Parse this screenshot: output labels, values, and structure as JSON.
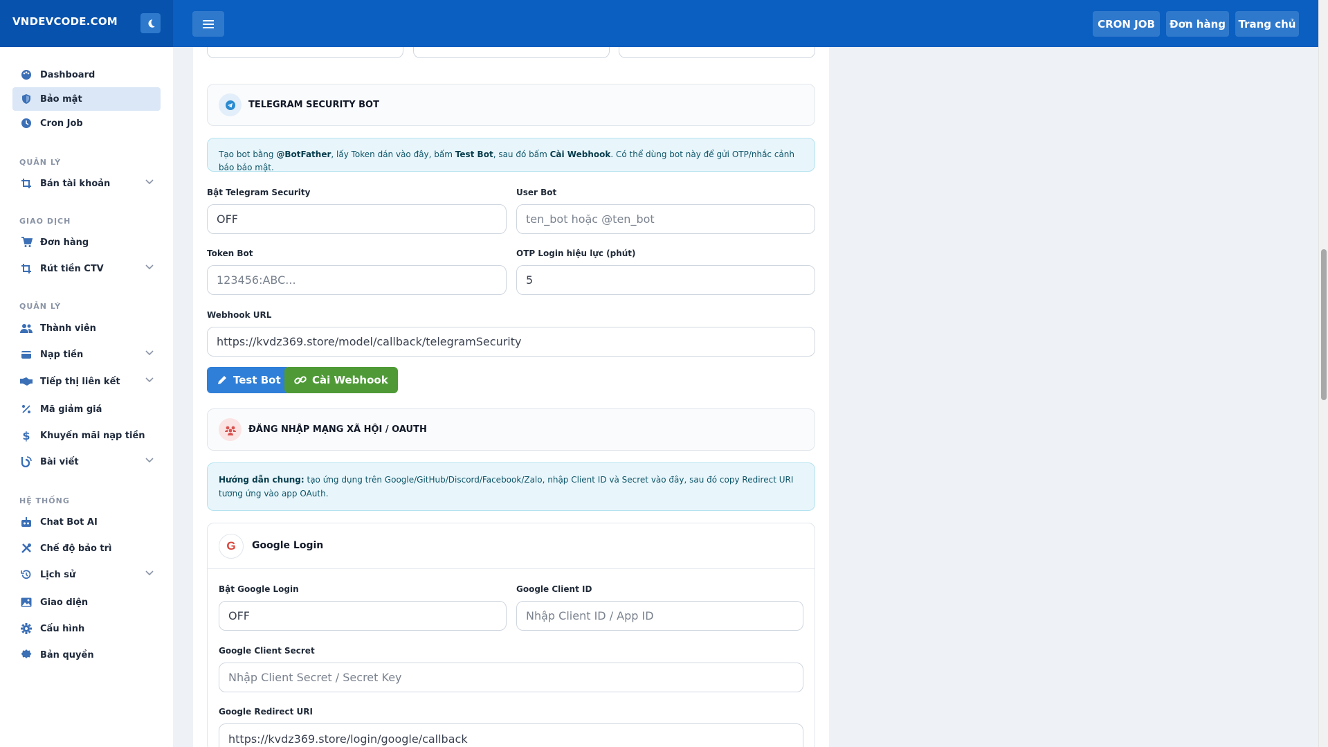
{
  "brand": "VNDEVCODE.COM",
  "topbar": {
    "buttons": [
      "CRON JOB",
      "Đơn hàng",
      "Trang chủ"
    ]
  },
  "sidebar": {
    "items": [
      {
        "label": "Dashboard",
        "icon": "palette-icon"
      },
      {
        "label": "Bảo mật",
        "icon": "shield-icon"
      },
      {
        "label": "Cron Job",
        "icon": "clock-icon"
      }
    ],
    "sections": [
      "QUẢN LÝ",
      "GIAO DỊCH",
      "QUẢN LÝ",
      "HỆ THỐNG"
    ],
    "section1": [
      {
        "label": "Bán tài khoản",
        "icon": "crop-icon"
      }
    ],
    "section2": [
      {
        "label": "Đơn hàng",
        "icon": "cart-icon"
      },
      {
        "label": "Rút tiền CTV",
        "icon": "crop-icon"
      }
    ],
    "section3": [
      {
        "label": "Thành viên",
        "icon": "users-icon"
      },
      {
        "label": "Nạp tiền",
        "icon": "wallet-icon"
      },
      {
        "label": "Tiếp thị liên kết",
        "icon": "handshake-icon"
      },
      {
        "label": "Mã giảm giá",
        "icon": "percent-icon"
      },
      {
        "label": "Khuyến mãi nạp tiền",
        "icon": "dollar-icon"
      },
      {
        "label": "Bài viết",
        "icon": "blog-icon"
      }
    ],
    "section4": [
      {
        "label": "Chat Bot AI",
        "icon": "robot-icon"
      },
      {
        "label": "Chế độ bảo trì",
        "icon": "tools-icon"
      },
      {
        "label": "Lịch sử",
        "icon": "history-icon"
      },
      {
        "label": "Giao diện",
        "icon": "image-icon"
      },
      {
        "label": "Cấu hình",
        "icon": "gear-icon"
      },
      {
        "label": "Bản quyền",
        "icon": "certificate-icon"
      }
    ]
  },
  "telegram": {
    "title": "TELEGRAM SECURITY BOT",
    "alert": {
      "t1": "Tạo bot bằng ",
      "b1": "@BotFather",
      "t2": ", lấy Token dán vào đây, bấm ",
      "b2": "Test Bot",
      "t3": ", sau đó bấm ",
      "b3": "Cài Webhook",
      "t4": ". Có thể dùng bot này để gửi OTP/nhắc cảnh báo bảo mật."
    },
    "enable_label": "Bật Telegram Security",
    "enable_value": "OFF",
    "userbot_label": "User Bot",
    "userbot_placeholder": "ten_bot hoặc @ten_bot",
    "token_label": "Token Bot",
    "token_placeholder": "123456:ABC...",
    "otp_label": "OTP Login hiệu lực (phút)",
    "otp_value": "5",
    "webhook_label": "Webhook URL",
    "webhook_value": "https://kvdz369.store/model/callback/telegramSecurity",
    "test_button": "Test Bot",
    "webhook_button": "Cài Webhook"
  },
  "oauth": {
    "title": "ĐĂNG NHẬP MẠNG XÃ HỘI / OAUTH",
    "alert_bold": "Hướng dẫn chung:",
    "alert_text": " tạo ứng dụng trên Google/GitHub/Discord/Facebook/Zalo, nhập Client ID và Secret vào đây, sau đó copy Redirect URI tương ứng vào app OAuth."
  },
  "google": {
    "title": "Google Login",
    "enable_label": "Bật Google Login",
    "enable_value": "OFF",
    "client_id_label": "Google Client ID",
    "client_id_placeholder": "Nhập Client ID / App ID",
    "secret_label": "Google Client Secret",
    "secret_placeholder": "Nhập Client Secret / Secret Key",
    "redirect_label": "Google Redirect URI",
    "redirect_value": "https://kvdz369.store/login/google/callback"
  },
  "colors": {
    "topbar": "#0a5fc0",
    "primary_button": "#2f7fd8",
    "success_button": "#4f9a37",
    "info_alert": "#e8f6fb"
  }
}
